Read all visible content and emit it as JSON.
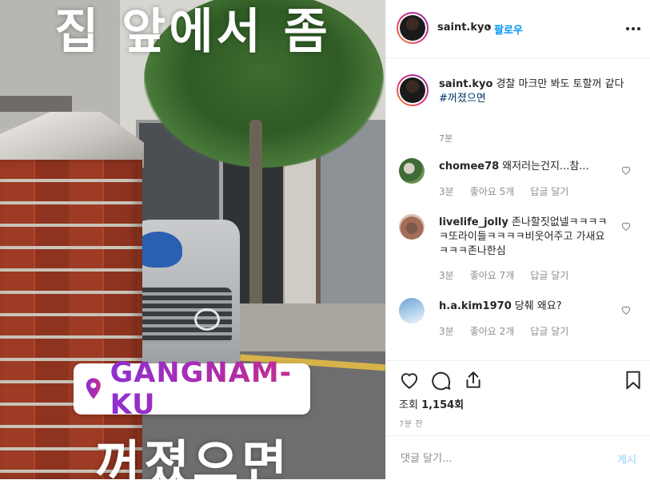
{
  "story": {
    "top_text": "집 앞에서 좀",
    "location": "GANGNAM-KU",
    "bottom_text": "꺼졌으면"
  },
  "header": {
    "username": "saint.kyo",
    "separator": "•",
    "follow_label": "팔로우"
  },
  "caption": {
    "username": "saint.kyo",
    "text": "경찰 마크만 봐도 토할꺼 같다",
    "hashtag": "#꺼졌으면",
    "time": "7분"
  },
  "comments": [
    {
      "username": "chomee78",
      "text": "왜저러는건지...참...",
      "time": "3분",
      "likes": "좋아요 5개",
      "reply": "답글 달기"
    },
    {
      "username": "livelife_jolly",
      "text": "존나할짓없넬ㅋㅋㅋㅋㅋ또라이들ㅋㅋㅋㅋ비웃어주고 가새요 ㅋㅋㅋ존나한심",
      "time": "3분",
      "likes": "좋아요 7개",
      "reply": "답글 달기"
    },
    {
      "username": "h.a.kim1970",
      "text": "당췌 왜요?",
      "time": "3분",
      "likes": "좋아요 2개",
      "reply": "답글 달기"
    }
  ],
  "stats": {
    "views_label": "조회",
    "views_count": "1,154회",
    "posted": "7분 전"
  },
  "add_comment": {
    "placeholder": "댓글 달기...",
    "post_label": "게시"
  },
  "colors": {
    "link_blue": "#0095f6",
    "hashtag": "#00376b",
    "muted": "#8e8e8e",
    "post_disabled": "#b2dffc"
  }
}
